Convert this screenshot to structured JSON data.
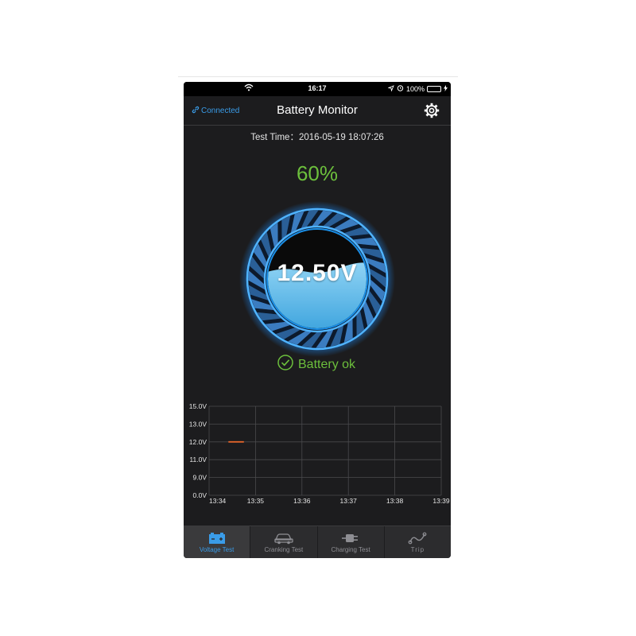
{
  "status_bar": {
    "time": "16:17",
    "battery_percent": "100%"
  },
  "nav": {
    "connected_label": "Connected",
    "title": "Battery Monitor"
  },
  "test_time": "Test Time：2016-05-19 18:07:26",
  "charge_percent": "60%",
  "charge_level": 0.6,
  "voltage": "12.50V",
  "battery_status": "Battery ok",
  "colors": {
    "accent": "#3a9ce8",
    "ok_green": "#6cbf3c",
    "line_orange": "#e0632a",
    "background": "#1c1c1e"
  },
  "chart_data": {
    "type": "line",
    "x_ticks": [
      "13:34",
      "13:35",
      "13:36",
      "13:37",
      "13:38",
      "13:39"
    ],
    "y_ticks": [
      "0.0V",
      "9.0V",
      "11.0V",
      "12.0V",
      "13.0V",
      "15.0V"
    ],
    "series": [
      {
        "color": "#e0632a",
        "points": [
          {
            "x": "13:34:25",
            "y": 12.0
          },
          {
            "x": "13:34:45",
            "y": 12.0
          }
        ]
      }
    ],
    "grid": true
  },
  "tabs": [
    {
      "label": "Voltage Test",
      "icon": "battery-icon",
      "active": true
    },
    {
      "label": "Cranking Test",
      "icon": "car-icon",
      "active": false
    },
    {
      "label": "Charging Test",
      "icon": "plug-icon",
      "active": false
    },
    {
      "label": "Trip",
      "icon": "route-icon",
      "active": false
    }
  ]
}
